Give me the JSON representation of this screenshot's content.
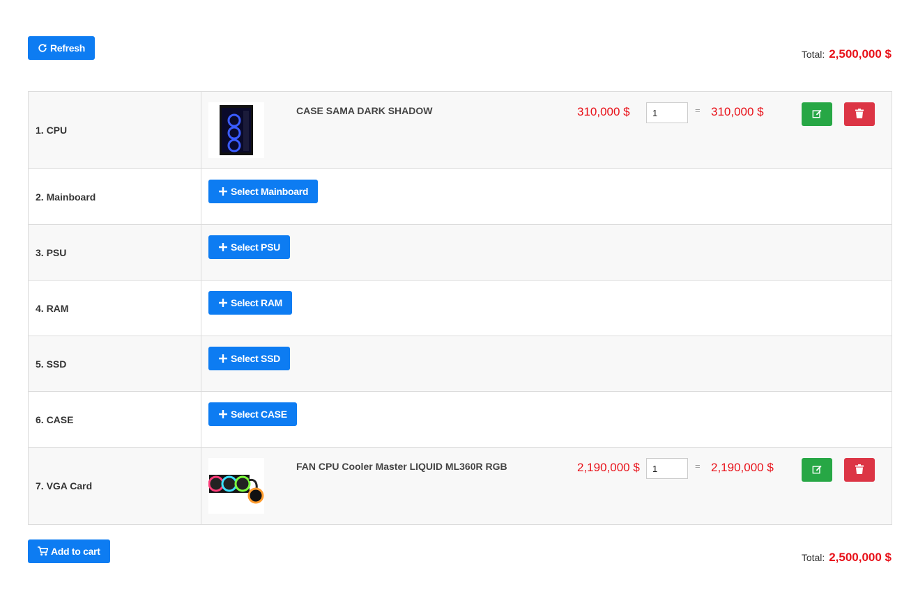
{
  "header": {
    "refresh_label": "Refresh",
    "total_label": "Total:",
    "total_value": "2,500,000 $"
  },
  "slots": [
    {
      "label": "1. CPU",
      "product": {
        "name": "CASE SAMA DARK SHADOW",
        "unit_price": "310,000 $",
        "quantity": "1",
        "equals": "=",
        "line_total": "310,000 $"
      }
    },
    {
      "label": "2. Mainboard",
      "select_label": "Select Mainboard"
    },
    {
      "label": "3. PSU",
      "select_label": "Select PSU"
    },
    {
      "label": "4. RAM",
      "select_label": "Select RAM"
    },
    {
      "label": "5. SSD",
      "select_label": "Select SSD"
    },
    {
      "label": "6. CASE",
      "select_label": "Select CASE"
    },
    {
      "label": "7. VGA Card",
      "product": {
        "name": "FAN CPU Cooler Master LIQUID ML360R RGB",
        "unit_price": "2,190,000 $",
        "quantity": "1",
        "equals": "=",
        "line_total": "2,190,000 $"
      }
    }
  ],
  "footer": {
    "add_to_cart_label": "Add to cart",
    "total_label": "Total:",
    "total_value": "2,500,000 $"
  },
  "icons": {
    "refresh": "refresh-icon",
    "plus": "plus-icon",
    "edit": "edit-icon",
    "delete": "trash-icon",
    "cart": "cart-icon"
  },
  "colors": {
    "primary": "#0d7cf2",
    "success": "#27a745",
    "danger": "#dc3545",
    "price": "#e8121a"
  }
}
